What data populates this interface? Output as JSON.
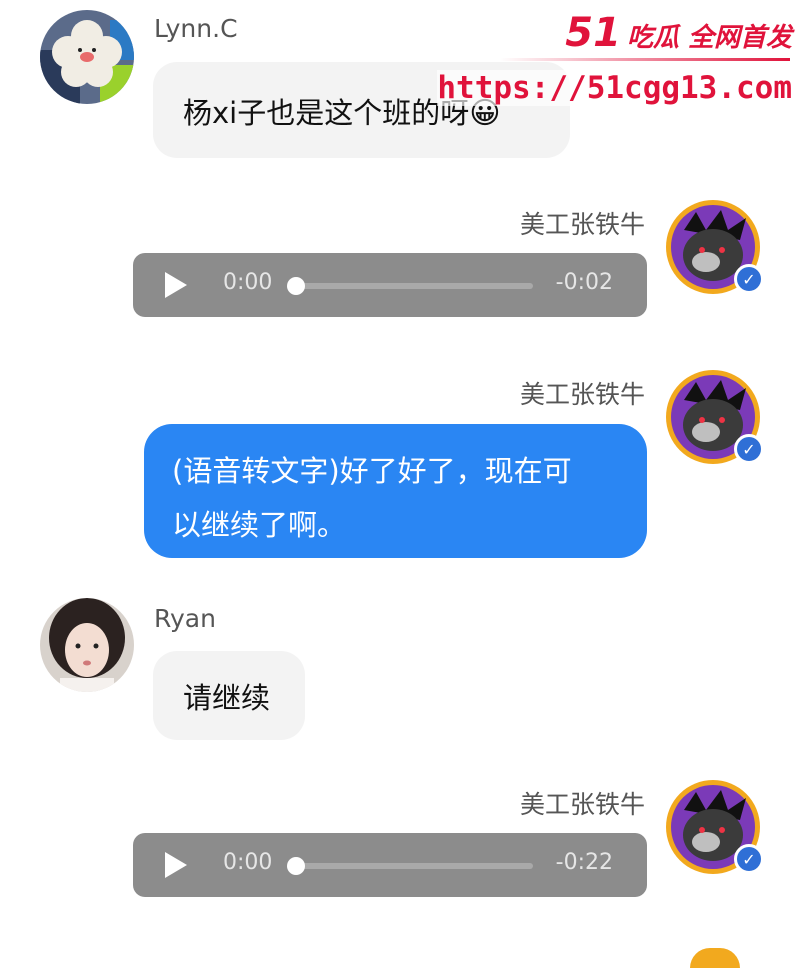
{
  "watermark": {
    "logo_number": "51",
    "logo_text": "吃瓜 全网首发",
    "url": "https://51cgg13.com"
  },
  "messages": [
    {
      "sender": "Lynn.C",
      "type": "text",
      "side": "left",
      "text": "杨xi子也是这个班的呀",
      "emoji": "😀"
    },
    {
      "sender": "美工张铁牛",
      "type": "audio",
      "side": "right",
      "current": "0:00",
      "remaining": "-0:02"
    },
    {
      "sender": "美工张铁牛",
      "type": "text",
      "side": "right",
      "text_line1": "(语音转文字)好了好了，现在可",
      "text_line2": "以继续了啊。"
    },
    {
      "sender": "Ryan",
      "type": "text",
      "side": "left",
      "text": "请继续"
    },
    {
      "sender": "美工张铁牛",
      "type": "audio",
      "side": "right",
      "current": "0:00",
      "remaining": "-0:22"
    }
  ],
  "colors": {
    "bubble_blue": "#2a86f3",
    "bubble_gray": "#f3f3f3",
    "audio_bg": "#8c8c8c",
    "verified_badge": "#2f6fd6",
    "watermark": "#e0133b"
  },
  "icons": {
    "verified": "check-badge-icon",
    "play": "play-icon"
  }
}
